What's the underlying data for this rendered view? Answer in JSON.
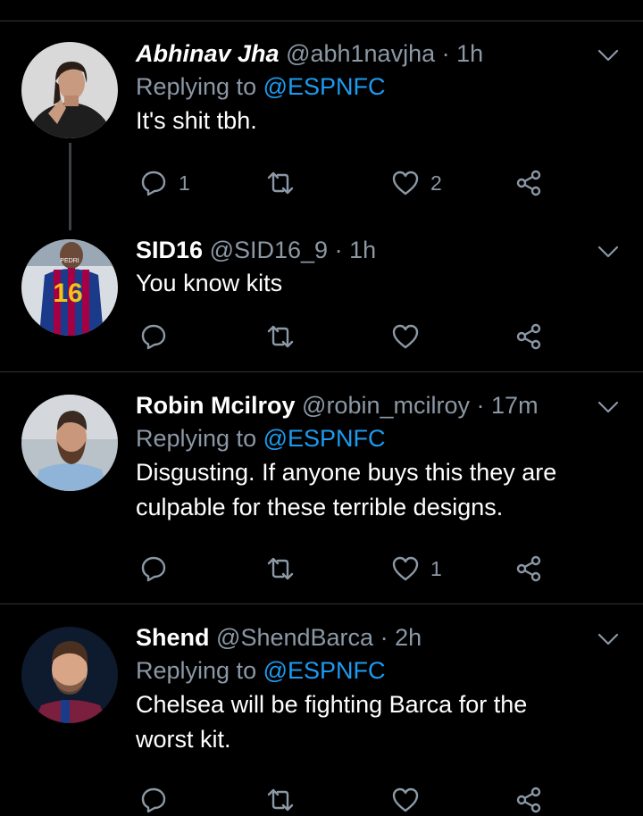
{
  "colors": {
    "background": "#000000",
    "muted": "#8b98a5",
    "mention": "#1d9bf0",
    "divider": "#2f3336"
  },
  "tweets": [
    {
      "name": "Abhinav Jha",
      "handle": "@abh1navjha",
      "sep": "·",
      "time": "1h",
      "replying_prefix": "Replying to ",
      "replying_to": "@ESPNFC",
      "text": "It's shit tbh.",
      "reply_count": "1",
      "retweet_count": "",
      "like_count": "2"
    },
    {
      "name": "SID16",
      "handle": "@SID16_9",
      "sep": "·",
      "time": "1h",
      "text": "You know kits",
      "reply_count": "",
      "retweet_count": "",
      "like_count": ""
    },
    {
      "name": "Robin Mcilroy",
      "handle": "@robin_mcilroy",
      "sep": "·",
      "time": "17m",
      "replying_prefix": "Replying to ",
      "replying_to": "@ESPNFC",
      "text_line1": "Disgusting. If anyone buys this they are",
      "text_line2": "culpable for these terrible designs.",
      "reply_count": "",
      "retweet_count": "",
      "like_count": "1"
    },
    {
      "name": "Shend",
      "handle": "@ShendBarca",
      "sep": "·",
      "time": "2h",
      "replying_prefix": "Replying to ",
      "replying_to": "@ESPNFC",
      "text_line1": "Chelsea will be fighting Barca for the",
      "text_line2": "worst kit."
    }
  ],
  "icons": {
    "reply": "reply-icon",
    "retweet": "retweet-icon",
    "like": "heart-icon",
    "share": "share-icon",
    "more": "chevron-down-icon"
  }
}
